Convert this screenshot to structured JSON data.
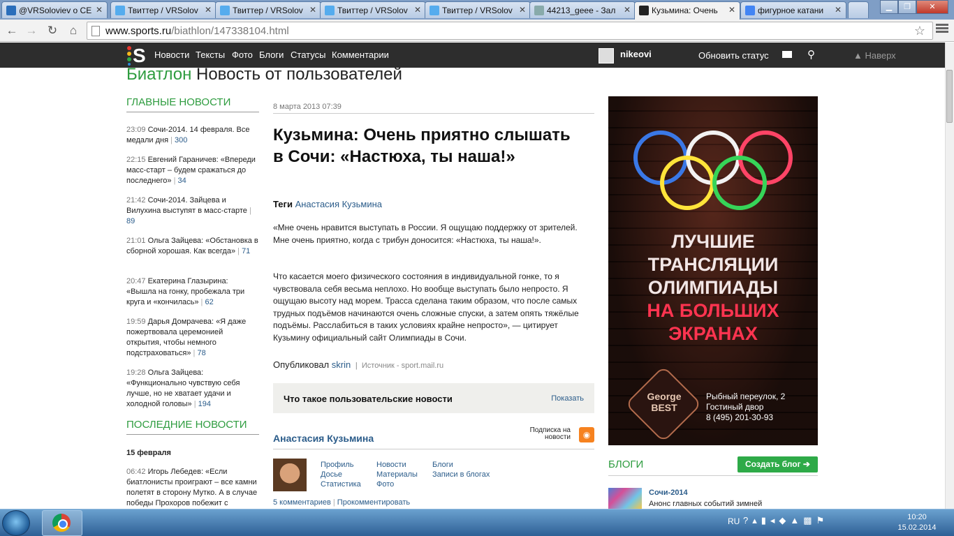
{
  "browser": {
    "tabs": [
      {
        "label": "@VRSoloviev о СЕ",
        "fav": "#2a6ebb"
      },
      {
        "label": "Твиттер / VRSolov",
        "fav": "#55acee"
      },
      {
        "label": "Твиттер / VRSolov",
        "fav": "#55acee"
      },
      {
        "label": "Твиттер / VRSolov",
        "fav": "#55acee"
      },
      {
        "label": "Твиттер / VRSolov",
        "fav": "#55acee"
      },
      {
        "label": "44213_geee - Зал",
        "fav": "#8aa"
      },
      {
        "label": "Кузьмина: Очень",
        "fav": "#222",
        "active": true
      },
      {
        "label": "фигурное катани",
        "fav": "#4285f4"
      }
    ],
    "url_host": "www.sports.ru",
    "url_path": "/biathlon/147338104.html"
  },
  "site": {
    "nav": [
      "Новости",
      "Тексты",
      "Фото",
      "Блоги",
      "Статусы",
      "Комментарии"
    ],
    "username": "nikeovi",
    "update_status": "Обновить статус",
    "to_top": "▲ Наверх"
  },
  "section": {
    "name": "Биатлон",
    "title": "Новость от пользователей"
  },
  "main_news": {
    "heading": "ГЛАВНЫЕ НОВОСТИ",
    "items": [
      {
        "time": "23:09",
        "text": "Сочи-2014. 14 февраля. Все медали дня",
        "count": "300"
      },
      {
        "time": "22:15",
        "text": "Евгений Гараничев: «Впереди масс-старт – будем сражаться до последнего»",
        "count": "34"
      },
      {
        "time": "21:42",
        "text": "Сочи-2014. Зайцева и Вилухина выступят в масс-старте",
        "count": "89"
      },
      {
        "time": "21:01",
        "text": "Ольга Зайцева: «Обстановка в сборной хорошая. Как всегда»",
        "count": "71"
      },
      {
        "time": "20:47",
        "text": "Екатерина Глазырина: «Вышла на гонку, пробежала три круга и «кончилась»",
        "count": "62"
      },
      {
        "time": "19:59",
        "text": "Дарья Домрачева: «Я даже пожертвовала церемонией открытия, чтобы немного подстраховаться»",
        "count": "78"
      },
      {
        "time": "19:28",
        "text": "Ольга Зайцева: «Функционально чувствую себя лучше, но не хватает удачи и холодной головы»",
        "count": "194"
      }
    ]
  },
  "latest_news": {
    "heading": "ПОСЛЕДНИЕ НОВОСТИ",
    "date": "15 февраля",
    "item": {
      "time": "06:42",
      "text": "Игорь Лебедев: «Если биатлонисты проиграют – все камни полетят в сторону Мутко. А в случае победы Прохоров побежит с"
    }
  },
  "article": {
    "date": "8 марта 2013 07:39",
    "title": "Кузьмина: Очень приятно слышать в Сочи: «Настюха, ты наша!»",
    "tags_label": "Теги",
    "tag": "Анастасия Кузьмина",
    "p1": "«Мне очень нравится выступать в России. Я ощущаю поддержку от зрителей. Мне очень приятно, когда с трибун доносится: «Настюха, ты наша!».",
    "p2": "Что касается моего физического состояния в индивидуальной гонке, то я чувствовала себя весьма неплохо. Но вообще выступать было непросто. Я ощущаю высоту над морем. Трасса сделана таким образом, что после самых трудных подъёмов начинаются очень сложные спуски, а затем опять тяжёлые подъёмы. Расслабиться в таких условиях крайне непросто», — цитирует Кузьмину официальный сайт Олимпиады в Сочи.",
    "published_label": "Опубликовал",
    "author": "skrin",
    "source": "Источник - sport.mail.ru",
    "ugc_title": "Что такое пользовательские новости",
    "ugc_show": "Показать"
  },
  "person": {
    "name": "Анастасия Кузьмина",
    "subscribe": "Подписка на новости",
    "links": [
      "Профиль",
      "Новости",
      "Блоги",
      "Досье",
      "Материалы",
      "Записи в блогах",
      "Статистика",
      "Фото"
    ],
    "comments": "5 комментариев",
    "comment_action": "Прокомментировать"
  },
  "ad": {
    "line1": "ЛУЧШИЕ",
    "line2": "ТРАНСЛЯЦИИ",
    "line3": "ОЛИМПИАДЫ",
    "line4": "НА БОЛЬШИХ",
    "line5": "ЭКРАНАХ",
    "addr1": "Рыбный переулок, 2",
    "addr2": "Гостиный двор",
    "phone": "8 (495) 201-30-93",
    "logo": "George BEST"
  },
  "blogs": {
    "heading": "БЛОГИ",
    "create": "Создать блог ➔",
    "entry_title": "Сочи-2014",
    "entry_desc": "Анонс главных событий зимней"
  },
  "taskbar": {
    "lang": "RU",
    "time": "10:20",
    "date": "15.02.2014"
  },
  "colors": {
    "accent_green": "#2e9c3f",
    "link": "#2b5c8a",
    "header": "#2d2d2d"
  }
}
